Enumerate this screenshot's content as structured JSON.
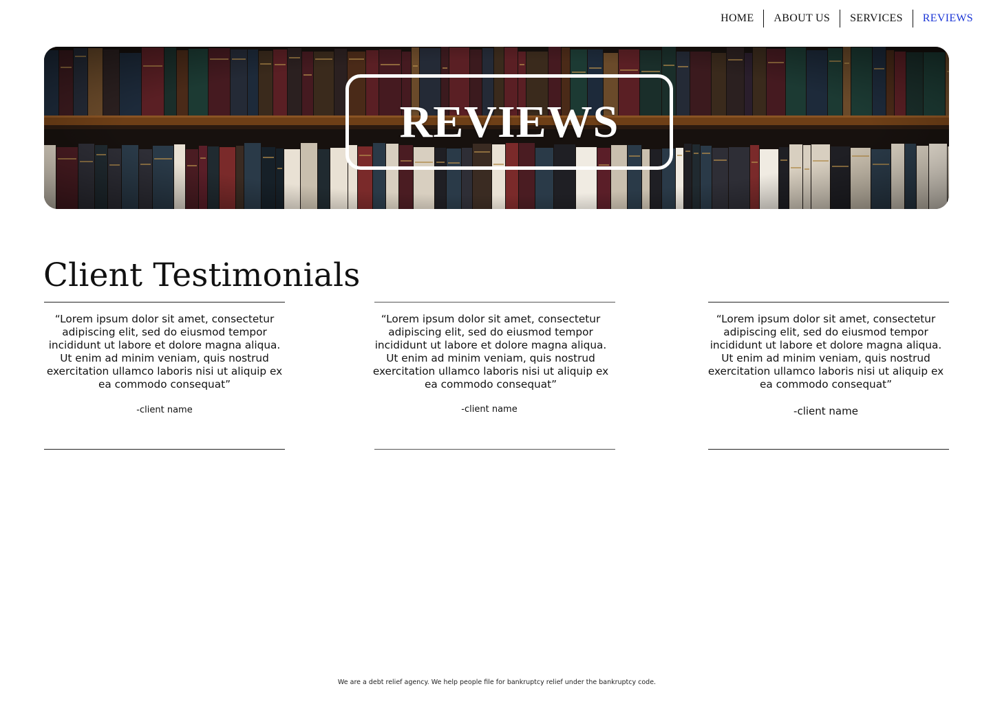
{
  "nav": {
    "items": [
      {
        "label": "HOME",
        "active": false
      },
      {
        "label": "ABOUT US",
        "active": false
      },
      {
        "label": "SERVICES",
        "active": false
      },
      {
        "label": "REVIEWS",
        "active": true
      }
    ],
    "active_color": "#1a35d6"
  },
  "hero": {
    "title": "REVIEWS",
    "background": "bookshelf-photo"
  },
  "section": {
    "title": "Client Testimonials"
  },
  "testimonials": [
    {
      "quote": "“Lorem ipsum dolor sit amet, consectetur adipiscing elit, sed do eiusmod tempor incididunt ut labore et dolore magna aliqua. Ut enim ad minim veniam, quis nostrud exercitation ullamco laboris nisi ut aliquip ex ea commodo consequat”",
      "client": "-client name"
    },
    {
      "quote": "“Lorem ipsum dolor sit amet, consectetur adipiscing elit, sed do eiusmod tempor incididunt ut labore et dolore magna aliqua. Ut enim ad minim veniam, quis nostrud exercitation ullamco laboris nisi ut aliquip ex ea commodo consequat”",
      "client": "-client name"
    },
    {
      "quote": "“Lorem ipsum dolor sit amet, consectetur adipiscing elit, sed do eiusmod tempor incididunt ut labore et dolore magna aliqua. Ut enim ad minim veniam, quis nostrud exercitation ullamco laboris nisi ut aliquip ex ea commodo consequat”",
      "client": "-client name"
    }
  ],
  "footer": {
    "text": "We are a debt relief agency. We help people file for bankruptcy relief under the bankruptcy code."
  }
}
